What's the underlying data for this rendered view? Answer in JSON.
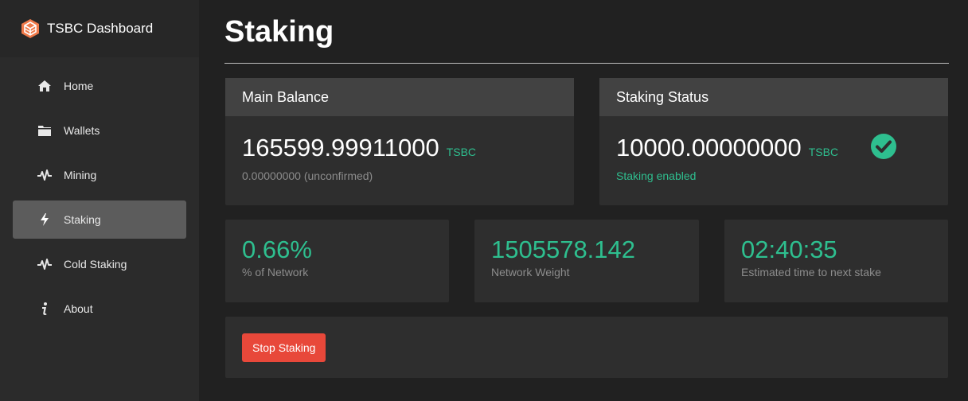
{
  "brand": {
    "title": "TSBC Dashboard",
    "icon": "tsbc-logo-icon"
  },
  "sidebar": {
    "items": [
      {
        "label": "Home",
        "icon": "home-icon",
        "active": false
      },
      {
        "label": "Wallets",
        "icon": "folder-icon",
        "active": false
      },
      {
        "label": "Mining",
        "icon": "pulse-icon",
        "active": false
      },
      {
        "label": "Staking",
        "icon": "lightning-icon",
        "active": true
      },
      {
        "label": "Cold Staking",
        "icon": "pulse-icon",
        "active": false
      },
      {
        "label": "About",
        "icon": "info-icon",
        "active": false
      }
    ]
  },
  "page": {
    "title": "Staking"
  },
  "balance": {
    "header": "Main Balance",
    "amount": "165599.99911000",
    "unit": "TSBC",
    "unconfirmed": "0.00000000 (unconfirmed)"
  },
  "status": {
    "header": "Staking Status",
    "amount": "10000.00000000",
    "unit": "TSBC",
    "text": "Staking enabled",
    "icon": "check-circle-icon"
  },
  "stats": [
    {
      "value": "0.66%",
      "label": "% of Network"
    },
    {
      "value": "1505578.142",
      "label": "Network Weight"
    },
    {
      "value": "02:40:35",
      "label": "Estimated time to next stake"
    }
  ],
  "actions": {
    "stop_label": "Stop Staking"
  },
  "colors": {
    "accent": "#2ebf8f",
    "danger": "#e8483a",
    "logo": "#f07a4a",
    "background": "#212121",
    "sidebar": "#2b2b2b",
    "card": "#2e2e2e",
    "card_header": "#424242"
  }
}
